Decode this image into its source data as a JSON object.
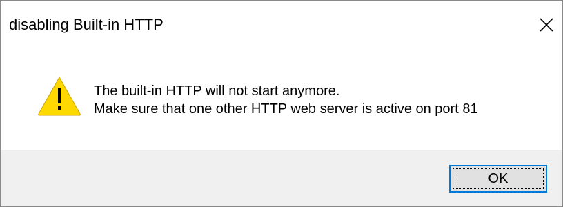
{
  "window": {
    "title": "disabling Built-in HTTP",
    "close_icon": "close-icon"
  },
  "message": {
    "icon": "warning-icon",
    "line1": "The built-in HTTP will not start anymore.",
    "line2": "Make sure that one other HTTP web server is active on port 81"
  },
  "buttons": {
    "ok_label": "OK"
  },
  "colors": {
    "accent": "#0078d7",
    "warning_fill": "#ffd800",
    "footer_bg": "#f0f0f0"
  }
}
